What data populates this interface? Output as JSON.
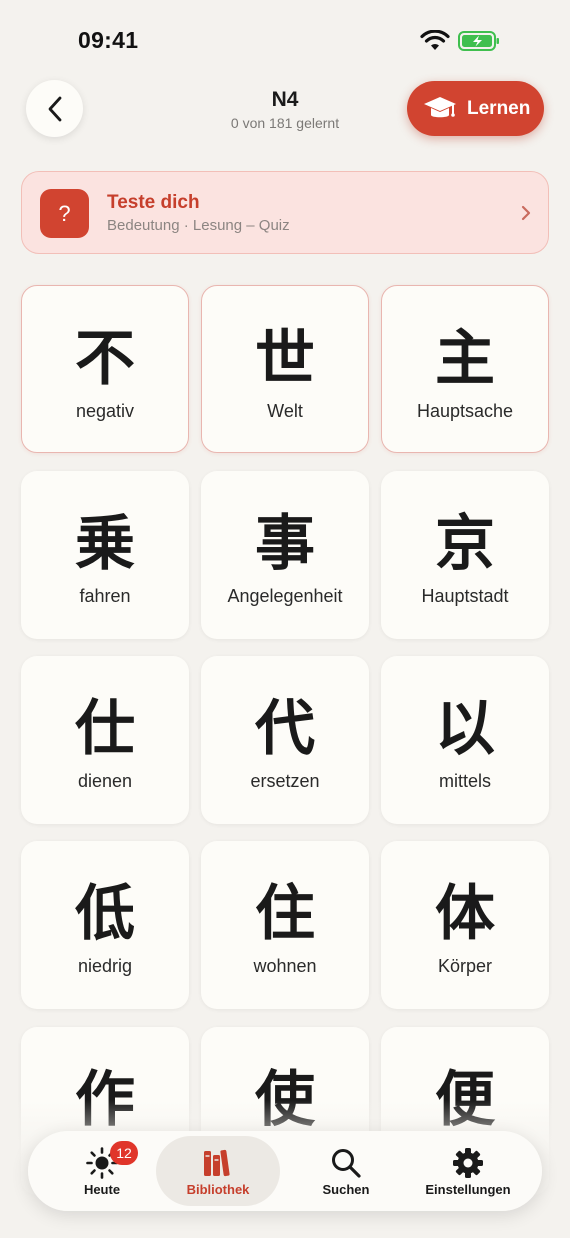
{
  "status_bar": {
    "time": "09:41"
  },
  "header": {
    "title": "N4",
    "subtitle": "0 von 181 gelernt",
    "learn_label": "Lernen"
  },
  "quiz_banner": {
    "icon_text": "?",
    "title": "Teste dich",
    "subtitle": "Bedeutung · Lesung – Quiz"
  },
  "cards": [
    {
      "kanji": "不",
      "meaning": "negativ"
    },
    {
      "kanji": "世",
      "meaning": "Welt"
    },
    {
      "kanji": "主",
      "meaning": "Hauptsache"
    },
    {
      "kanji": "乗",
      "meaning": "fahren"
    },
    {
      "kanji": "事",
      "meaning": "Angelegenheit"
    },
    {
      "kanji": "京",
      "meaning": "Hauptstadt"
    },
    {
      "kanji": "仕",
      "meaning": "dienen"
    },
    {
      "kanji": "代",
      "meaning": "ersetzen"
    },
    {
      "kanji": "以",
      "meaning": "mittels"
    },
    {
      "kanji": "低",
      "meaning": "niedrig"
    },
    {
      "kanji": "住",
      "meaning": "wohnen"
    },
    {
      "kanji": "体",
      "meaning": "Körper"
    },
    {
      "kanji": "作",
      "meaning": ""
    },
    {
      "kanji": "使",
      "meaning": ""
    },
    {
      "kanji": "便",
      "meaning": ""
    }
  ],
  "tab_bar": {
    "tabs": [
      {
        "label": "Heute",
        "icon": "sun-icon",
        "badge": "12"
      },
      {
        "label": "Bibliothek",
        "icon": "books-icon"
      },
      {
        "label": "Suchen",
        "icon": "search-icon"
      },
      {
        "label": "Einstellungen",
        "icon": "gear-icon"
      }
    ]
  },
  "colors": {
    "accent": "#d14430",
    "background": "#f4f2ee",
    "card": "#fdfcf8",
    "banner_bg": "#fbe3e0"
  }
}
